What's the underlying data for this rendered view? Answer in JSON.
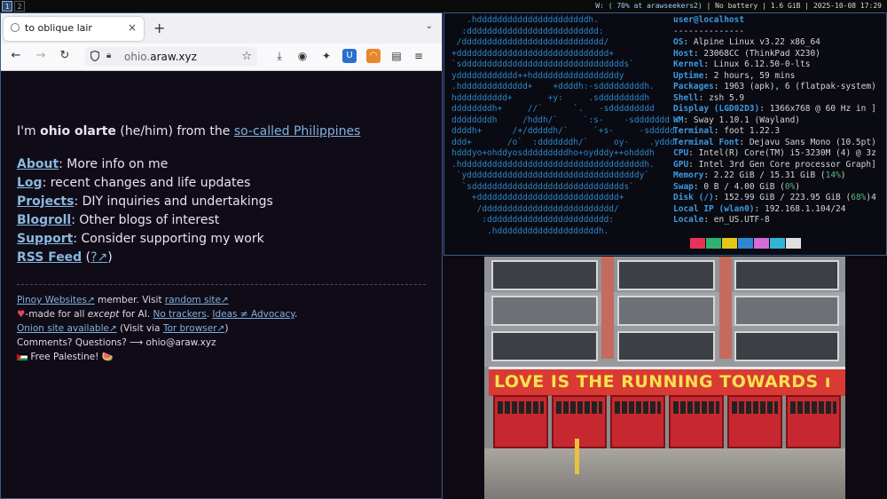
{
  "topbar": {
    "workspaces": [
      "1",
      "2"
    ],
    "status_w": "W: ( 70% at arawseekers2)",
    "status_battery": "No battery",
    "status_mem": "1.6 GiB",
    "status_datetime": "2025-10-08 17:29"
  },
  "browser": {
    "tab_title": "to oblique lair",
    "tab_close": "×",
    "new_tab": "+",
    "url_prefix": "ohio.",
    "url_domain": "araw.xyz"
  },
  "page": {
    "intro_pre": "I'm ",
    "intro_name": "ohio olarte",
    "intro_mid": " (he/him) from the ",
    "intro_link": "so-called Philippines",
    "nav": [
      {
        "label": "About",
        "desc": ": More info on me"
      },
      {
        "label": "Log",
        "desc": ": recent changes and life updates"
      },
      {
        "label": "Projects",
        "desc": ": DIY inquiries and undertakings"
      },
      {
        "label": "Blogroll",
        "desc": ": Other blogs of interest"
      },
      {
        "label": "Support",
        "desc": ": Consider supporting my work"
      },
      {
        "label": "RSS Feed",
        "desc": "",
        "help": "?↗"
      }
    ],
    "footer": {
      "l1_link": "Pinoy Websites↗",
      "l1_mid": " member. Visit ",
      "l1_link2": "random site↗",
      "l2_heart": "♥",
      "l2_a": "-made for all ",
      "l2_em": "except",
      "l2_b": " for AI. ",
      "l2_link1": "No trackers",
      "l2_c": ". ",
      "l2_link2": "Ideas ≠ Advocacy",
      "l2_d": ".",
      "l3_link": "Onion site available↗",
      "l3_mid": " (Visit via ",
      "l3_link2": "Tor browser↗",
      "l3_end": ")",
      "l4": "Comments? Questions? ⟶ ohio@araw.xyz",
      "l5": " Free Palestine! 🍉"
    }
  },
  "terminal": {
    "ascii": "   .hddddddddddddddddddddddh.\n  :dddddddddddddddddddddddddd:\n /dddddddddddddddddddddddddddd/\n+dddddddddddddddddddddddddddddd+\n`sdddddddddddddddddddddddddddddddds`\nydddddddddddd++hdddddddddddddddddy\n.hddddddddddddd+    +ddddh:-sdddddddddh.\nhdddddddddd+       +y:     .sdddddddddh\nddddddddh+     //`      `.   -sddddddddd\nddddddddh     /hddh/`     `:s-    -sddddddd\nddddh+      /+/dddddh/`     `+s-     -sddddd\nddd+       /o`  :dddddddh/`     oy-    .yddd\nhdddyo+ohddyosdddddddddho+oydddy++ohdddh\n.hddddddddddddddddddddddddddddddddddddh.\n `yddddddddddddddddddddddddddddddddddy`\n  `sdddddddddddddddddddddddddddddds`\n    +dddddddddddddddddddddddddddd+\n     /dddddddddddddddddddddddddd/\n      :dddddddddddddddddddddddd:\n       .hddddddddddddddddddddh.",
    "user": "user@localhost",
    "divider": "--------------",
    "info": [
      {
        "k": "OS",
        "v": "Alpine Linux v3.22 x86_64"
      },
      {
        "k": "Host",
        "v": "23068CC (ThinkPad X230)"
      },
      {
        "k": "Kernel",
        "v": "Linux 6.12.50-0-lts"
      },
      {
        "k": "Uptime",
        "v": "2 hours, 59 mins"
      },
      {
        "k": "Packages",
        "v": "1963 (apk), 6 (flatpak-system)"
      },
      {
        "k": "Shell",
        "v": "zsh 5.9"
      },
      {
        "k": "Display (LGD02D3)",
        "v": "1366x768 @ 60 Hz in ]"
      },
      {
        "k": "WM",
        "v": "Sway 1.10.1 (Wayland)"
      },
      {
        "k": "Terminal",
        "v": "foot 1.22.3"
      },
      {
        "k": "Terminal Font",
        "v": "Dejavu Sans Mono (10.5pt)"
      },
      {
        "k": "CPU",
        "v": "Intel(R) Core(TM) i5-3230M (4) @ 3z"
      },
      {
        "k": "GPU",
        "v": "Intel 3rd Gen Core processor Graph]"
      },
      {
        "k": "Memory",
        "v": "2.22 GiB / 15.31 GiB (",
        "p": "14%",
        "e": ")"
      },
      {
        "k": "Swap",
        "v": "0 B / 4.00 GiB (",
        "p": "0%",
        "e": ")"
      },
      {
        "k": "Disk (/)",
        "v": "152.99 GiB / 223.95 GiB (",
        "p": "68%",
        "e": ")4"
      },
      {
        "k": "Local IP (wlan0)",
        "v": "192.168.1.104/24"
      },
      {
        "k": "Locale",
        "v": "en_US.UTF-8"
      }
    ],
    "palette": [
      "#e6335c",
      "#2db36d",
      "#e6c619",
      "#2f86d1",
      "#d66ad6",
      "#31b5d6",
      "#e0e0e0"
    ]
  },
  "photo": {
    "banner": "LOVE IS THE RUNNING TOWARDS ı"
  }
}
